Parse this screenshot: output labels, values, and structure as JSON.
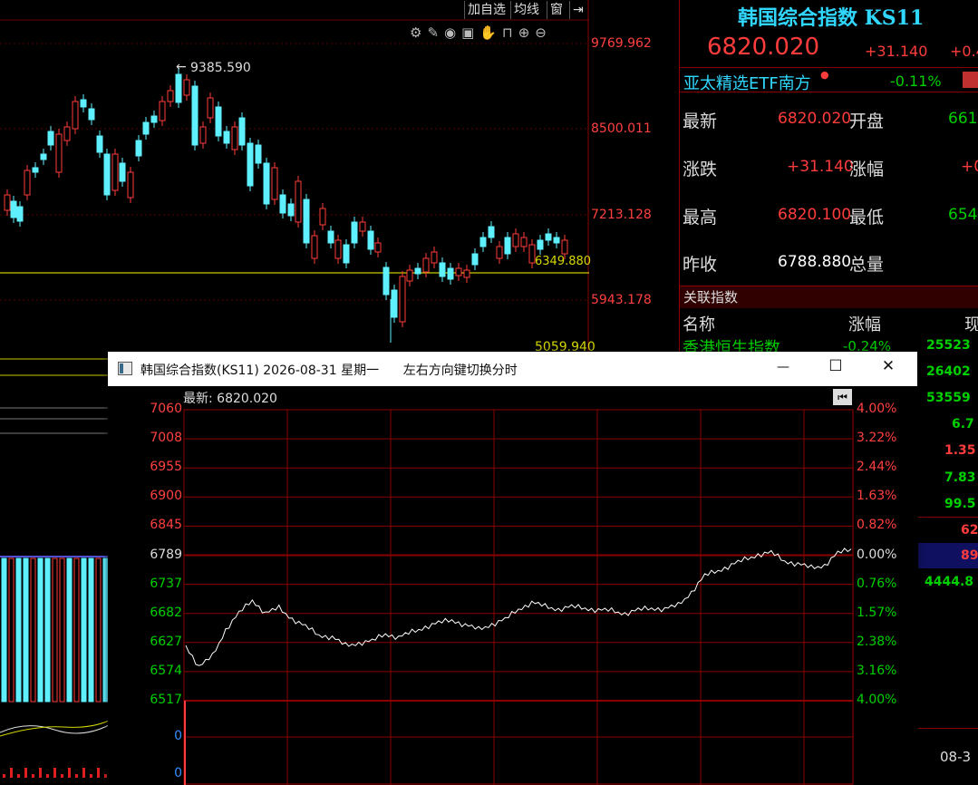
{
  "toolbar": {
    "add": "加自选",
    "ma": "均线",
    "window": "窗",
    "exit_icon": "exit-arrow-icon"
  },
  "kline": {
    "y_ticks": [
      "9769.962",
      "8500.011",
      "7213.128",
      "5943.178",
      "5059.940"
    ],
    "high_marker": "9385.590",
    "ref_value": "6349.880"
  },
  "quote": {
    "title": "韩国综合指数 KS11",
    "last": "6820.020",
    "change": "+31.140",
    "change_pct_partial": "+0.4",
    "etf_name": "亚太精选ETF南方",
    "etf_pct": "-0.11%",
    "rows": [
      {
        "l1": "最新",
        "v1": "6820.020",
        "l2": "开盘",
        "v2": "661"
      },
      {
        "l1": "涨跌",
        "v1": "+31.140",
        "l2": "涨幅",
        "v2": "+0"
      },
      {
        "l1": "最高",
        "v1": "6820.100",
        "l2": "最低",
        "v2": "654"
      },
      {
        "l1": "昨收",
        "v1": "6788.880",
        "l2": "总量",
        "v2": ""
      }
    ],
    "related_header": "关联指数",
    "col_name": "名称",
    "col_pct": "涨幅",
    "col_partial": "现",
    "related": [
      {
        "name": "香港恒生指数",
        "pct": "-0.24%",
        "val": "25523"
      }
    ],
    "extra_vals": [
      "26402",
      "53559",
      "6.7",
      "1.35",
      "7.83",
      "99.5",
      "62",
      "89",
      "4444.8"
    ],
    "date_partial": "08-3"
  },
  "popup": {
    "title": "韩国综合指数(KS11) 2026-08-31 星期一      左右方向键切换分时",
    "latest_label": "最新: 6820.020",
    "minimize": "—",
    "maximize": "☐",
    "close": "✕"
  },
  "chart_data": {
    "type": "line",
    "title": "",
    "reference": 6788.88,
    "ylim": [
      6517,
      7060
    ],
    "left_ticks": [
      "7060",
      "7008",
      "6955",
      "6900",
      "6845",
      "6789",
      "6737",
      "6682",
      "6627",
      "6574",
      "6517"
    ],
    "right_ticks": [
      "4.00%",
      "3.22%",
      "2.44%",
      "1.63%",
      "0.82%",
      "0.00%",
      "0.76%",
      "1.57%",
      "2.38%",
      "3.16%",
      "4.00%"
    ],
    "volume_ticks": [
      "0",
      "0"
    ],
    "x": [
      0,
      2,
      4,
      6,
      8,
      10,
      12,
      14,
      16,
      18,
      20,
      22,
      24,
      26,
      28,
      30,
      32,
      34,
      36,
      38,
      40,
      42,
      44,
      46,
      48,
      50,
      52,
      54,
      56,
      58,
      60,
      62,
      64,
      66,
      68,
      70,
      72,
      74,
      76,
      78,
      80,
      82,
      84,
      86,
      88,
      90,
      92,
      94,
      96,
      98,
      100
    ],
    "values": [
      6620,
      6580,
      6600,
      6650,
      6680,
      6705,
      6680,
      6690,
      6670,
      6655,
      6640,
      6635,
      6620,
      6625,
      6628,
      6642,
      6635,
      6645,
      6655,
      6662,
      6668,
      6658,
      6650,
      6660,
      6668,
      6688,
      6700,
      6693,
      6688,
      6692,
      6690,
      6686,
      6685,
      6680,
      6686,
      6690,
      6688,
      6695,
      6720,
      6750,
      6760,
      6770,
      6780,
      6790,
      6793,
      6778,
      6772,
      6765,
      6770,
      6792,
      6800
    ]
  }
}
